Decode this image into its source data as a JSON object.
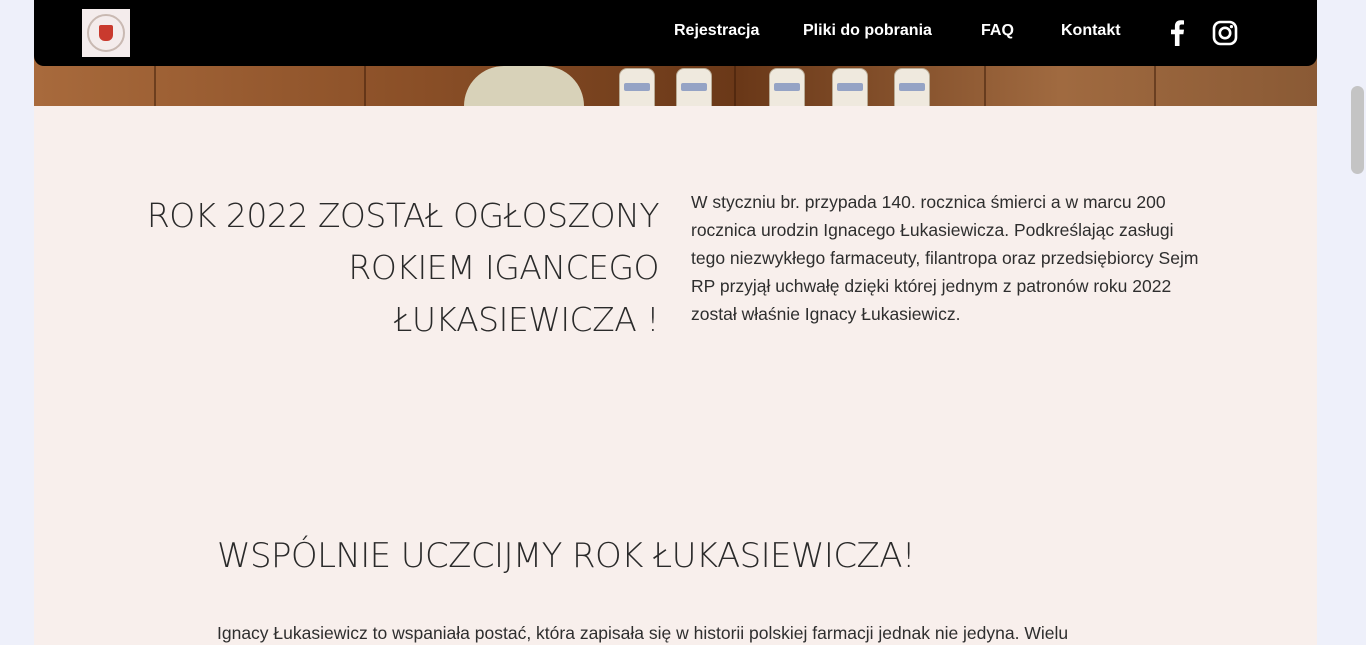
{
  "nav": {
    "logo_alt": "logo",
    "links": [
      "Rejestracja",
      "Pliki do pobrania",
      "FAQ",
      "Kontakt"
    ],
    "social": [
      "facebook-icon",
      "instagram-icon"
    ]
  },
  "hero": {
    "headline": "ROK 2022 ZOSTAŁ OGŁOSZONY ROKIEM IGANCEGO ŁUKASIEWICZA !",
    "intro": "W styczniu br. przypada 140. rocznica śmierci a w marcu 200 rocznica urodzin Ignacego Łukasiewicza. Podkreślając zasługi tego niezwykłego farmaceuty, filantropa oraz przedsiębiorcy Sejm RP przyjął uchwałę dzięki której jednym z patronów roku 2022 został właśnie Ignacy Łukasiewicz."
  },
  "section": {
    "title": "WSPÓLNIE UCZCIJMY ROK ŁUKASIEWICZA!",
    "body": "Ignacy Łukasiewicz to wspaniała postać, która zapisała się w historii polskiej farmacji jednak nie jedyna. Wielu"
  },
  "colors": {
    "navbar": "#000000",
    "background": "#f8efec",
    "page": "#eef0fa",
    "text": "#2a2a2a"
  }
}
